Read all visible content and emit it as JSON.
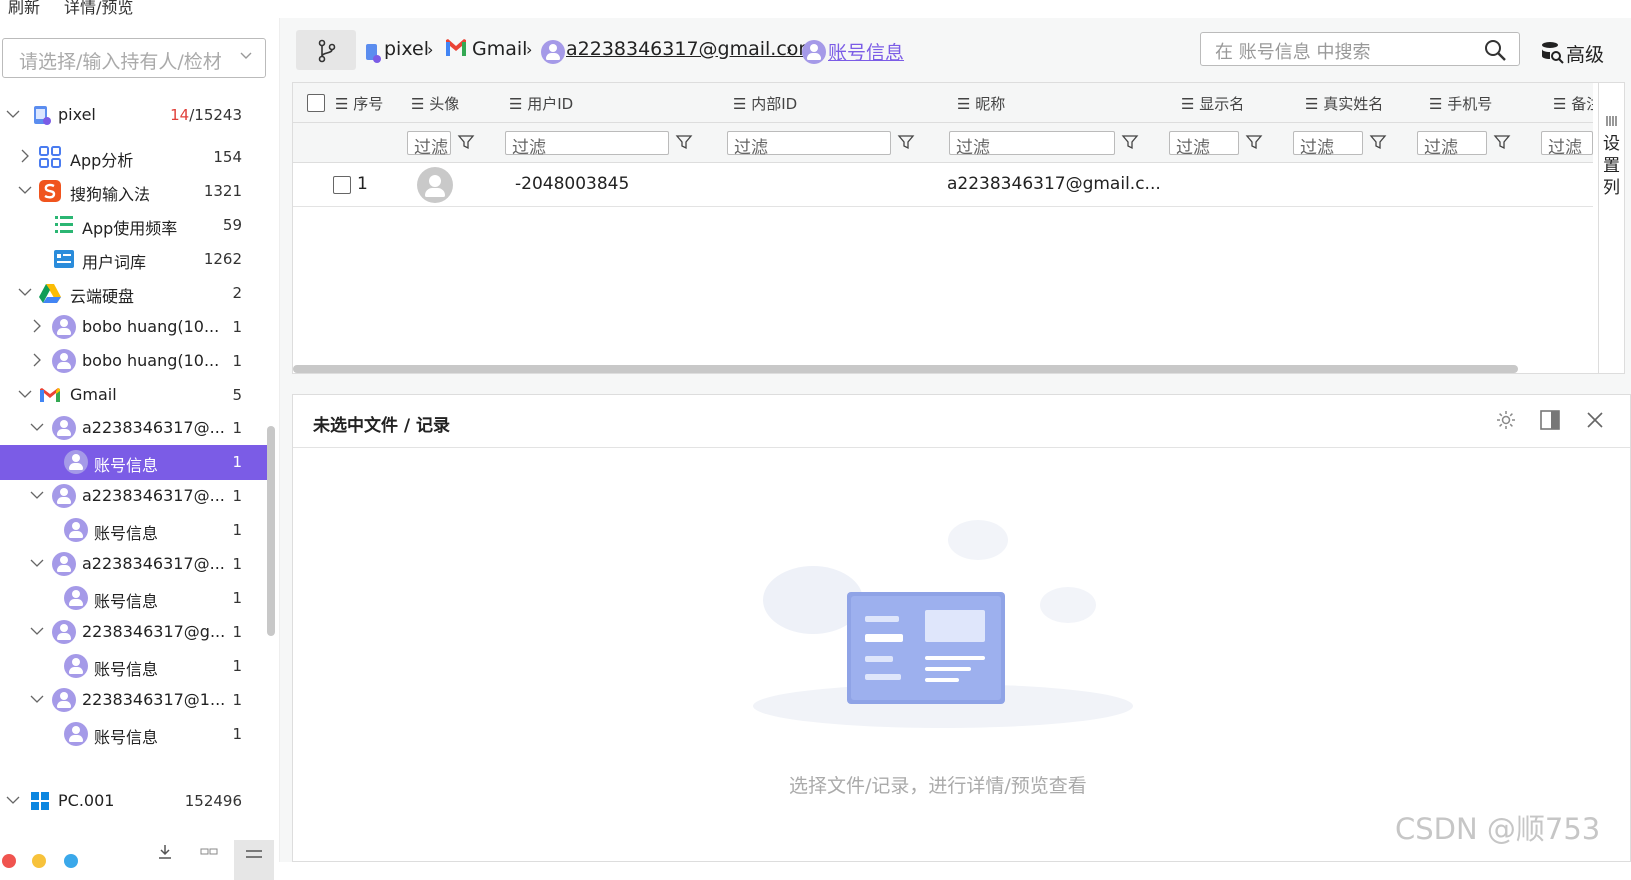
{
  "topbar": {
    "refresh": "刷新",
    "detail_preview": "详情/预览"
  },
  "holder_select": {
    "placeholder": "请选择/输入持有人/检材"
  },
  "tree": [
    {
      "label": "pixel",
      "count_sel": "14",
      "count_total": "/15243"
    },
    {
      "label": "App分析",
      "count": "154"
    },
    {
      "label": "搜狗输入法",
      "count": "1321"
    },
    {
      "label": "App使用频率",
      "count": "59"
    },
    {
      "label": "用户词库",
      "count": "1262"
    },
    {
      "label": "云端硬盘",
      "count": "2"
    },
    {
      "label": "bobo huang(10...",
      "count": "1"
    },
    {
      "label": "bobo huang(10...",
      "count": "1"
    },
    {
      "label": "Gmail",
      "count": "5"
    },
    {
      "label": "a2238346317@...",
      "count": "1"
    },
    {
      "label": "账号信息",
      "count": "1"
    },
    {
      "label": "a2238346317@...",
      "count": "1"
    },
    {
      "label": "账号信息",
      "count": "1"
    },
    {
      "label": "a2238346317@...",
      "count": "1"
    },
    {
      "label": "账号信息",
      "count": "1"
    },
    {
      "label": "2238346317@g...",
      "count": "1"
    },
    {
      "label": "账号信息",
      "count": "1"
    },
    {
      "label": "2238346317@1...",
      "count": "1"
    },
    {
      "label": "账号信息",
      "count": "1"
    },
    {
      "label": "PC.001",
      "count": "152496"
    }
  ],
  "breadcrumb": {
    "pixel": "pixel",
    "gmail": "Gmail",
    "account": "a2238346317@gmail.com",
    "current": "账号信息"
  },
  "search": {
    "placeholder": "在 账号信息 中搜索",
    "advanced": "高级"
  },
  "grid": {
    "columns": [
      "序号",
      "头像",
      "用户ID",
      "内部ID",
      "昵称",
      "显示名",
      "真实姓名",
      "手机号",
      "备注"
    ],
    "filter_placeholder": "过滤",
    "rows": [
      {
        "index": "1",
        "user_id": "-2048003845",
        "nickname": "a2238346317@gmail.c..."
      }
    ],
    "settings_col": "设置列"
  },
  "preview": {
    "title": "未选中文件 / 记录",
    "empty_text": "选择文件/记录，进行详情/预览查看"
  },
  "watermark": "CSDN @顺753",
  "colors": {
    "accent": "#7b5ce6",
    "avatar": "#a59ae8"
  }
}
